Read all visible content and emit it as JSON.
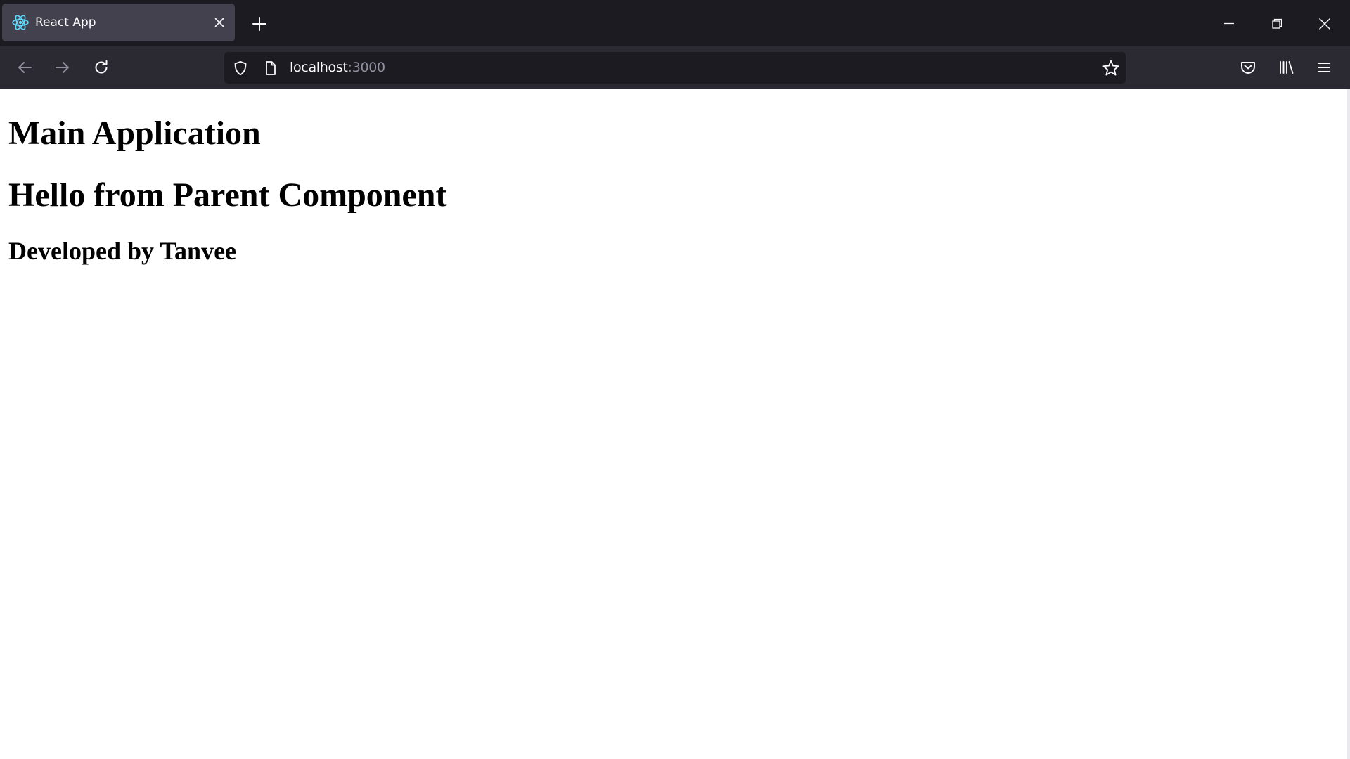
{
  "browser": {
    "tab": {
      "title": "React App"
    },
    "url": {
      "host": "localhost",
      "port": ":3000"
    }
  },
  "page": {
    "heading_main": "Main Application",
    "heading_parent": "Hello from Parent Component",
    "heading_developer": "Developed by Tanvee"
  },
  "icons": {
    "favicon": "react-logo-icon",
    "tab_close": "close-icon",
    "new_tab": "plus-icon",
    "minimize": "minimize-icon",
    "restore": "restore-icon",
    "close_window": "close-icon",
    "back": "arrow-left-icon",
    "forward": "arrow-right-icon",
    "reload": "reload-icon",
    "tracking": "shield-icon",
    "page_info": "page-icon",
    "bookmark": "star-icon",
    "pocket": "pocket-icon",
    "library": "library-icon",
    "menu": "hamburger-menu-icon"
  },
  "colors": {
    "titlebar": "#1c1b22",
    "active_tab": "#42414d",
    "navbar": "#2b2a33",
    "urlbar": "#1c1b22",
    "react_logo": "#61dafb",
    "page_background": "#ffffff",
    "page_text": "#000000"
  }
}
